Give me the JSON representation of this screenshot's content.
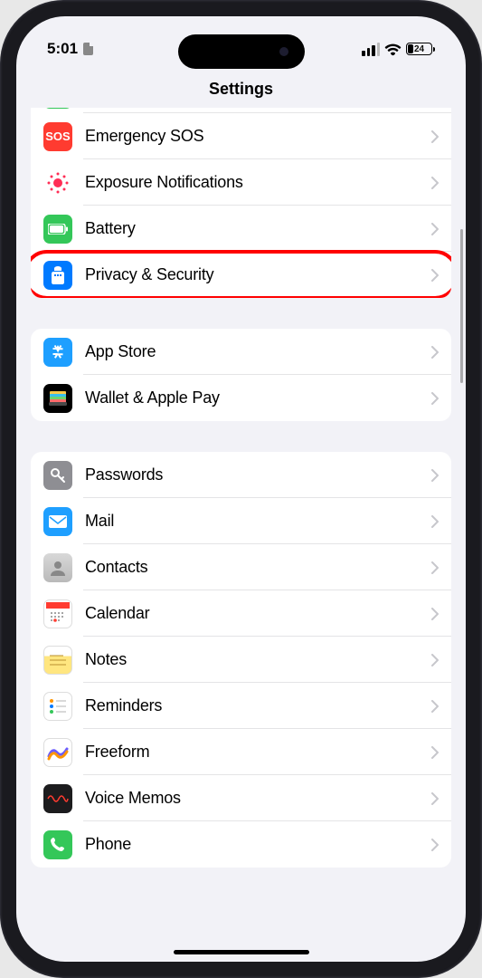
{
  "status": {
    "time": "5:01",
    "battery_pct": "24"
  },
  "header": {
    "title": "Settings"
  },
  "sections": [
    {
      "items": [
        {
          "id": "peek",
          "label": "",
          "icon": "peek"
        },
        {
          "id": "sos",
          "label": "Emergency SOS",
          "icon": "sos"
        },
        {
          "id": "exposure",
          "label": "Exposure Notifications",
          "icon": "exposure"
        },
        {
          "id": "battery",
          "label": "Battery",
          "icon": "battery"
        },
        {
          "id": "privacy",
          "label": "Privacy & Security",
          "icon": "privacy",
          "highlighted": true
        }
      ]
    },
    {
      "items": [
        {
          "id": "appstore",
          "label": "App Store",
          "icon": "appstore"
        },
        {
          "id": "wallet",
          "label": "Wallet & Apple Pay",
          "icon": "wallet"
        }
      ]
    },
    {
      "items": [
        {
          "id": "passwords",
          "label": "Passwords",
          "icon": "passwords"
        },
        {
          "id": "mail",
          "label": "Mail",
          "icon": "mail"
        },
        {
          "id": "contacts",
          "label": "Contacts",
          "icon": "contacts"
        },
        {
          "id": "calendar",
          "label": "Calendar",
          "icon": "calendar"
        },
        {
          "id": "notes",
          "label": "Notes",
          "icon": "notes"
        },
        {
          "id": "reminders",
          "label": "Reminders",
          "icon": "reminders"
        },
        {
          "id": "freeform",
          "label": "Freeform",
          "icon": "freeform"
        },
        {
          "id": "voicememos",
          "label": "Voice Memos",
          "icon": "voicememos"
        },
        {
          "id": "phone",
          "label": "Phone",
          "icon": "phone"
        }
      ]
    }
  ]
}
